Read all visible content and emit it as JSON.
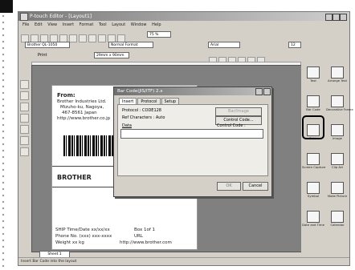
{
  "window_title": "P-touch Editor - [Layout1]",
  "menu": [
    "File",
    "Edit",
    "View",
    "Insert",
    "Format",
    "Tool",
    "Layout",
    "Window",
    "Help"
  ],
  "toolbar": {
    "printer": "Brother QL-1050",
    "normal_format": "Normal Format",
    "font": "Arial",
    "font_size": "12",
    "zoom": "75 %",
    "paper": "29mm x 90mm",
    "print_label": "Print"
  },
  "label": {
    "from_heading": "From:",
    "from_lines": [
      "Brother Industries Ltd.",
      "Mizuho-ku, Nagoya,",
      "467-8561 Japan",
      "http://www.brother.co.jp"
    ],
    "brand": "BROTHER",
    "footer_rows": [
      [
        "SHIP Time/Date  xx/xx/xx",
        "Box 1of 1"
      ],
      [
        "Phone No.  (xxx) xxx-xxxx",
        "URL"
      ],
      [
        "Weight  xx kg",
        "http://www.brother.com"
      ]
    ]
  },
  "dialog": {
    "title": "Bar Code(JIS/ITF) 2.x",
    "tabs": [
      "Insert",
      "Protocol",
      "Setup"
    ],
    "protocol_line": "Protocol : CODE128",
    "ref_chars": "Ref Characters : Auto",
    "data_label": "Data",
    "control_label": "Control Code :",
    "btn_gray": "Bar/Image",
    "btn_control": "Control Code...",
    "btn_ok": "OK",
    "btn_cancel": "Cancel"
  },
  "right_panel": [
    {
      "label": "Text",
      "icon": "text-icon"
    },
    {
      "label": "Arrange Text",
      "icon": "arrange-text-icon"
    },
    {
      "label": "Bar Code",
      "icon": "barcode-icon"
    },
    {
      "label": "Decorative Frame",
      "icon": "frame-icon"
    },
    {
      "label": "Table",
      "icon": "table-icon"
    },
    {
      "label": "Image",
      "icon": "image-icon"
    },
    {
      "label": "Screen Capture",
      "icon": "screen-capture-icon"
    },
    {
      "label": "Clip Art",
      "icon": "clipart-icon"
    },
    {
      "label": "Symbol",
      "icon": "symbol-icon"
    },
    {
      "label": "Make Picture",
      "icon": "make-picture-icon"
    },
    {
      "label": "Date and Time",
      "icon": "date-time-icon"
    },
    {
      "label": "Calendar",
      "icon": "calendar-icon"
    }
  ],
  "sheet_tab": "Sheet 1",
  "status_text": "Insert Bar Code into the layout"
}
